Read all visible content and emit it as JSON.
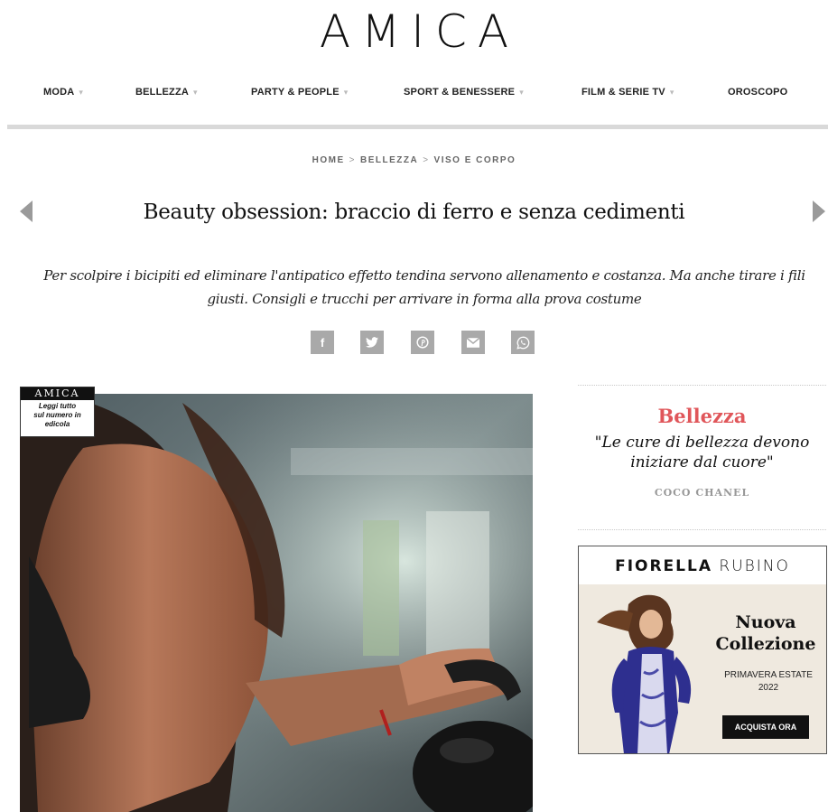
{
  "brand": {
    "logo": "AMICA"
  },
  "nav": {
    "items": [
      {
        "label": "MODA",
        "dropdown": true
      },
      {
        "label": "BELLEZZA",
        "dropdown": true
      },
      {
        "label": "PARTY & PEOPLE",
        "dropdown": true
      },
      {
        "label": "SPORT & BENESSERE",
        "dropdown": true
      },
      {
        "label": "FILM & SERIE TV",
        "dropdown": true
      },
      {
        "label": "OROSCOPO",
        "dropdown": false
      }
    ],
    "caret_glyph": "▾"
  },
  "breadcrumb": {
    "items": [
      "HOME",
      "BELLEZZA",
      "VISO E CORPO"
    ],
    "separator": ">"
  },
  "article": {
    "title": "Beauty obsession: braccio di ferro e senza cedimenti",
    "subtitle_line1": "Per scolpire i bicipiti ed eliminare l'antipatico effetto tendina servono allenamento e costanza. Ma anche tirare i fili",
    "subtitle_line2": "giusti. Consigli e trucchi per arrivare in forma alla prova costume"
  },
  "share": {
    "buttons": [
      "facebook-icon",
      "twitter-icon",
      "pinterest-icon",
      "email-icon",
      "whatsapp-icon"
    ],
    "facebook_glyph": "f",
    "color": "#a9a9a9"
  },
  "hero_badge": {
    "masthead": "AMICA",
    "text_line1": "Leggi tutto",
    "text_line2": "sul numero in",
    "text_line3": "edicola"
  },
  "sidebar": {
    "quote": {
      "category": "Bellezza",
      "text": "\"Le cure di bellezza devono iniziare dal cuore\"",
      "author": "COCO CHANEL",
      "category_color": "#e0565a"
    },
    "ad": {
      "brand_first": "FIORELLA",
      "brand_second": "RUBINO",
      "headline_line1": "Nuova",
      "headline_line2": "Collezione",
      "sub_line1": "PRIMAVERA ESTATE",
      "sub_line2": "2022",
      "cta": "ACQUISTA ORA"
    }
  }
}
